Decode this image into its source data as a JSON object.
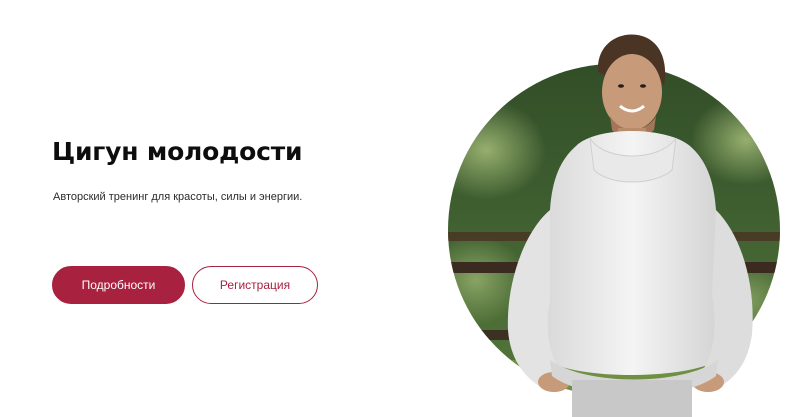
{
  "hero": {
    "title": "Цигун молодости",
    "subtitle": "Авторский тренинг для красоты, силы и энергии."
  },
  "buttons": {
    "details_label": "Подробности",
    "register_label": "Регистрация"
  },
  "colors": {
    "accent": "#a8213f",
    "title_text": "#0d0d0d",
    "background": "#ffffff"
  }
}
